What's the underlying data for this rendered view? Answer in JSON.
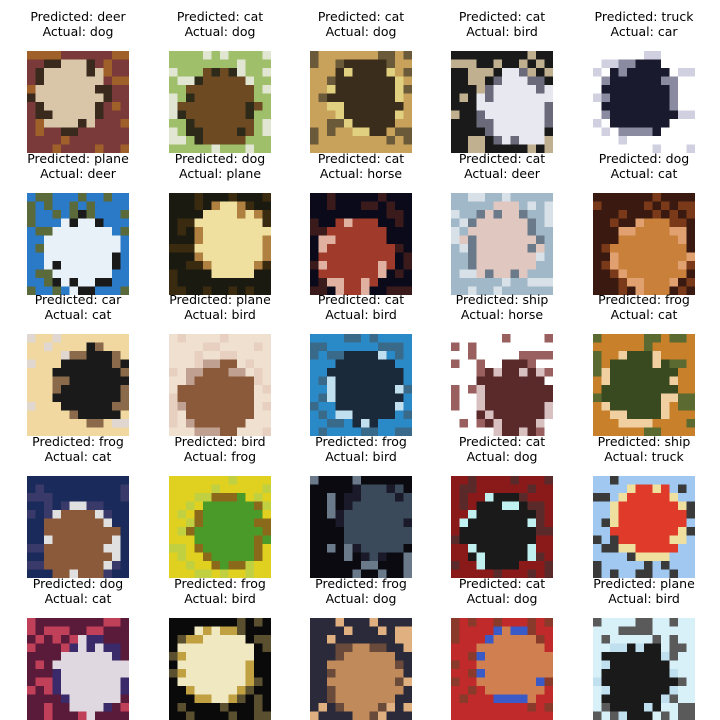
{
  "grid": {
    "cells": [
      {
        "predicted": "Predicted: deer",
        "actual": "Actual: dog",
        "depicts": "dog",
        "palette": [
          "#7a3a3a",
          "#d9c6a8",
          "#3a2a1e",
          "#a0602a"
        ]
      },
      {
        "predicted": "Predicted: cat",
        "actual": "Actual: dog",
        "depicts": "dog",
        "palette": [
          "#9fbf6a",
          "#6d4a22",
          "#2e2a1a",
          "#e0e6d2"
        ]
      },
      {
        "predicted": "Predicted: cat",
        "actual": "Actual: dog",
        "depicts": "dog",
        "palette": [
          "#c8a25a",
          "#3b2d1c",
          "#e0d080",
          "#6b5a3a"
        ]
      },
      {
        "predicted": "Predicted: cat",
        "actual": "Actual: bird",
        "depicts": "bird",
        "palette": [
          "#1a1a1a",
          "#e8e8f0",
          "#6a6a7a",
          "#c0b090"
        ]
      },
      {
        "predicted": "Predicted: truck",
        "actual": "Actual: car",
        "depicts": "car",
        "palette": [
          "#ffffff",
          "#1a1a2e",
          "#8a8aa0",
          "#d0d0e0"
        ]
      },
      {
        "predicted": "Predicted: plane",
        "actual": "Actual: deer",
        "depicts": "deer",
        "palette": [
          "#2a7ac8",
          "#e8f0f8",
          "#1a1a1a",
          "#5a6a3a"
        ]
      },
      {
        "predicted": "Predicted: dog",
        "actual": "Actual: plane",
        "depicts": "plane",
        "palette": [
          "#1a1a10",
          "#f0e0a0",
          "#b08040",
          "#3a2a10"
        ]
      },
      {
        "predicted": "Predicted: cat",
        "actual": "Actual: horse",
        "depicts": "horse",
        "palette": [
          "#0a0a1a",
          "#a03a2a",
          "#e0b0a0",
          "#3a1a1a"
        ]
      },
      {
        "predicted": "Predicted: cat",
        "actual": "Actual: deer",
        "depicts": "deer",
        "palette": [
          "#a0b8c8",
          "#e0c8c0",
          "#6a7a8a",
          "#d8e0e8"
        ]
      },
      {
        "predicted": "Predicted: dog",
        "actual": "Actual: cat",
        "depicts": "cat",
        "palette": [
          "#3a1a10",
          "#c8803a",
          "#e0a070",
          "#7a3a1a"
        ]
      },
      {
        "predicted": "Predicted: car",
        "actual": "Actual: cat",
        "depicts": "cat",
        "palette": [
          "#f0d8a0",
          "#1a1a1a",
          "#8a6a4a",
          "#e0d8d0"
        ]
      },
      {
        "predicted": "Predicted: plane",
        "actual": "Actual: bird",
        "depicts": "bird",
        "palette": [
          "#f0e0d0",
          "#8a5a3a",
          "#c0a090",
          "#e8d0c0"
        ]
      },
      {
        "predicted": "Predicted: cat",
        "actual": "Actual: bird",
        "depicts": "bird",
        "palette": [
          "#2a8ac8",
          "#1a2a3a",
          "#c0e0f0",
          "#3a6a8a"
        ]
      },
      {
        "predicted": "Predicted: ship",
        "actual": "Actual: horse",
        "depicts": "horse",
        "palette": [
          "#ffffff",
          "#5a2a2a",
          "#d8c0c0",
          "#9a6060"
        ]
      },
      {
        "predicted": "Predicted: frog",
        "actual": "Actual: cat",
        "depicts": "cat",
        "palette": [
          "#c8802a",
          "#3a4a20",
          "#f0d0a0",
          "#5a6a30"
        ]
      },
      {
        "predicted": "Predicted: frog",
        "actual": "Actual: cat",
        "depicts": "cat",
        "palette": [
          "#1a2a5a",
          "#8a5a3a",
          "#e0e0e0",
          "#3a3a6a"
        ]
      },
      {
        "predicted": "Predicted: bird",
        "actual": "Actual: frog",
        "depicts": "frog",
        "palette": [
          "#e0d020",
          "#4a9a2a",
          "#8a6a1a",
          "#c0d040"
        ]
      },
      {
        "predicted": "Predicted: frog",
        "actual": "Actual: bird",
        "depicts": "bird",
        "palette": [
          "#0a0a10",
          "#3a4a5a",
          "#1a1a2a",
          "#6a7a8a"
        ]
      },
      {
        "predicted": "Predicted: cat",
        "actual": "Actual: dog",
        "depicts": "dog",
        "palette": [
          "#8a1a1a",
          "#1a1a1a",
          "#c0f0f0",
          "#5a2a2a"
        ]
      },
      {
        "predicted": "Predicted: ship",
        "actual": "Actual: truck",
        "depicts": "truck",
        "palette": [
          "#a0c8f0",
          "#e03a2a",
          "#f0e0a0",
          "#3a3a3a"
        ]
      },
      {
        "predicted": "Predicted: dog",
        "actual": "Actual: cat",
        "depicts": "cat",
        "palette": [
          "#5a1a3a",
          "#e0d8e0",
          "#3a2a6a",
          "#c0405a"
        ]
      },
      {
        "predicted": "Predicted: frog",
        "actual": "Actual: bird",
        "depicts": "bird",
        "palette": [
          "#0a0a0a",
          "#f0e8c0",
          "#c0a040",
          "#5a5030"
        ]
      },
      {
        "predicted": "Predicted: frog",
        "actual": "Actual: dog",
        "depicts": "dog",
        "palette": [
          "#2a2a3a",
          "#c08a5a",
          "#6a4a3a",
          "#e0b080"
        ]
      },
      {
        "predicted": "Predicted: cat",
        "actual": "Actual: dog",
        "depicts": "dog",
        "palette": [
          "#c02a2a",
          "#d08050",
          "#3a5ac8",
          "#8a3a2a"
        ]
      },
      {
        "predicted": "Predicted: plane",
        "actual": "Actual: bird",
        "depicts": "bird",
        "palette": [
          "#d8f0f8",
          "#1a1a1a",
          "#c0e0f0",
          "#5a5a5a"
        ]
      }
    ]
  }
}
